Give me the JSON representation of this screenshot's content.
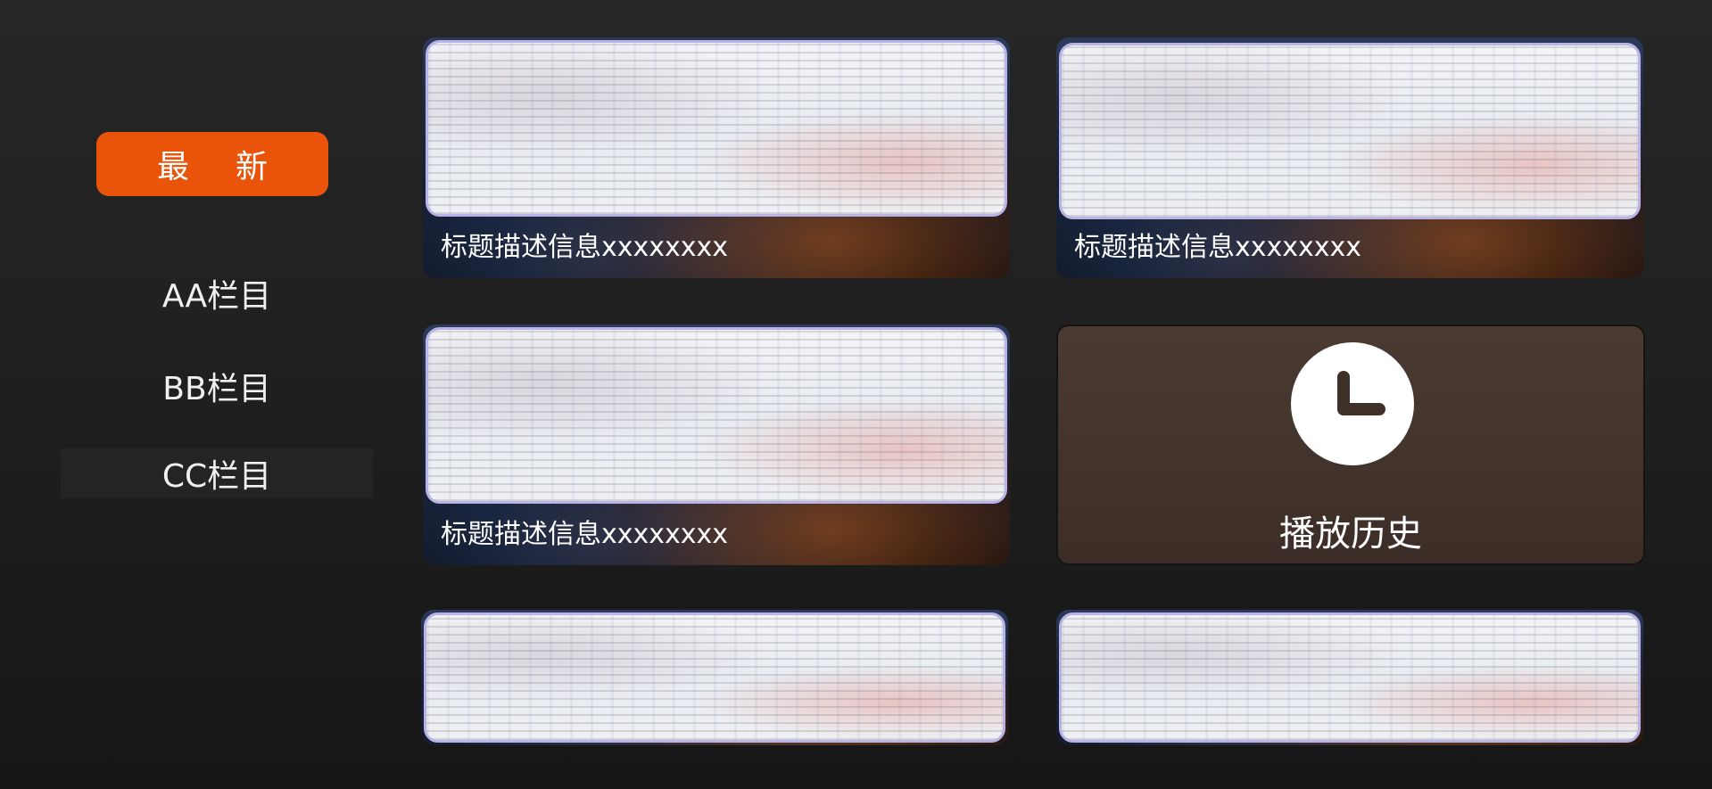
{
  "sidebar": {
    "active": {
      "label": "最新"
    },
    "items": [
      {
        "label": "AA栏目"
      },
      {
        "label": "BB栏目"
      },
      {
        "label": "CC栏目"
      }
    ]
  },
  "cards": [
    {
      "caption": "标题描述信息xxxxxxxx"
    },
    {
      "caption": "标题描述信息xxxxxxxx"
    },
    {
      "caption": "标题描述信息xxxxxxxx"
    }
  ],
  "history": {
    "label": "播放历史",
    "icon": "clock-icon"
  },
  "colors": {
    "accent": "#e9540a",
    "thumb_border": "#b9b3e6",
    "history_bg": "#4a3a32"
  }
}
